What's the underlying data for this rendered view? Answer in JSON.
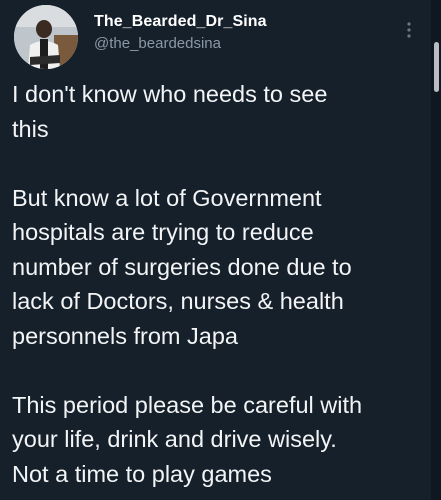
{
  "user": {
    "display_name": "The_Bearded_Dr_Sina",
    "handle": "@the_beardedsina"
  },
  "tweet": {
    "paragraphs": [
      [
        "I don't know who needs to see",
        "this"
      ],
      [
        "But know a lot of Government",
        "hospitals are trying to reduce",
        "number of surgeries done due to",
        "lack of Doctors, nurses & health",
        "personnels from Japa"
      ],
      [
        "This period please be careful with",
        "your life, drink and drive wisely.",
        "Not a time to play games"
      ]
    ]
  },
  "icons": {
    "more": "more-vertical-icon"
  }
}
